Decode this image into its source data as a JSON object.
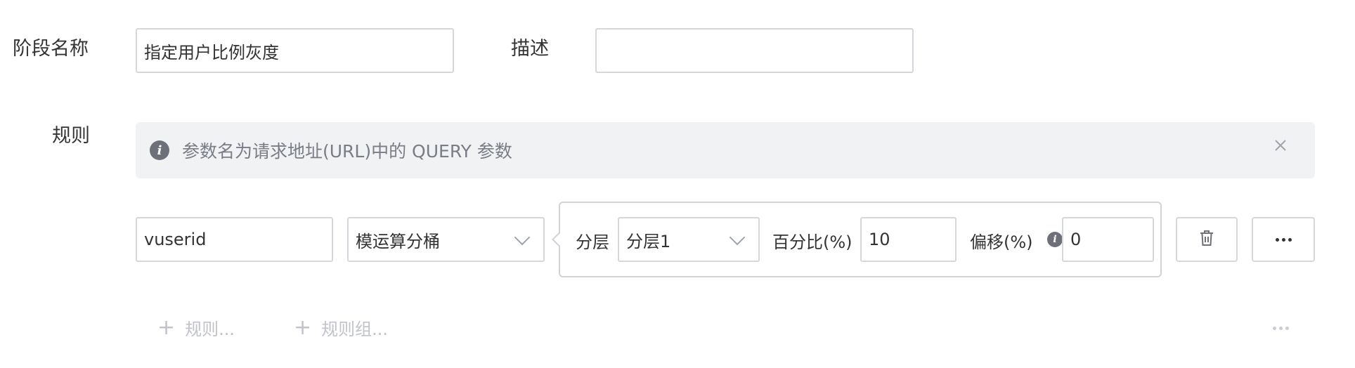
{
  "stage": {
    "name_label": "阶段名称",
    "name_value": "指定用户比例灰度",
    "desc_label": "描述",
    "desc_value": ""
  },
  "rules": {
    "label": "规则",
    "notice": "参数名为请求地址(URL)中的 QUERY 参数",
    "param_value": "vuserid",
    "operator_value": "模运算分桶",
    "popover": {
      "layer_label": "分层",
      "layer_value": "分层1",
      "percent_label": "百分比(%)",
      "percent_value": "10",
      "offset_label": "偏移(%)",
      "offset_value": "0"
    },
    "add_rule_label": "规则...",
    "add_group_label": "规则组..."
  },
  "icons": {
    "info": "info-icon",
    "close": "close-icon",
    "trash": "trash-icon",
    "more": "more-icon",
    "chevron": "chevron-down-icon",
    "plus": "plus-icon"
  },
  "colors": {
    "border": "#d4d7de",
    "alert_bg": "#f1f2f3",
    "muted_text": "#c0c3c9",
    "icon_grey": "#6e7079"
  }
}
